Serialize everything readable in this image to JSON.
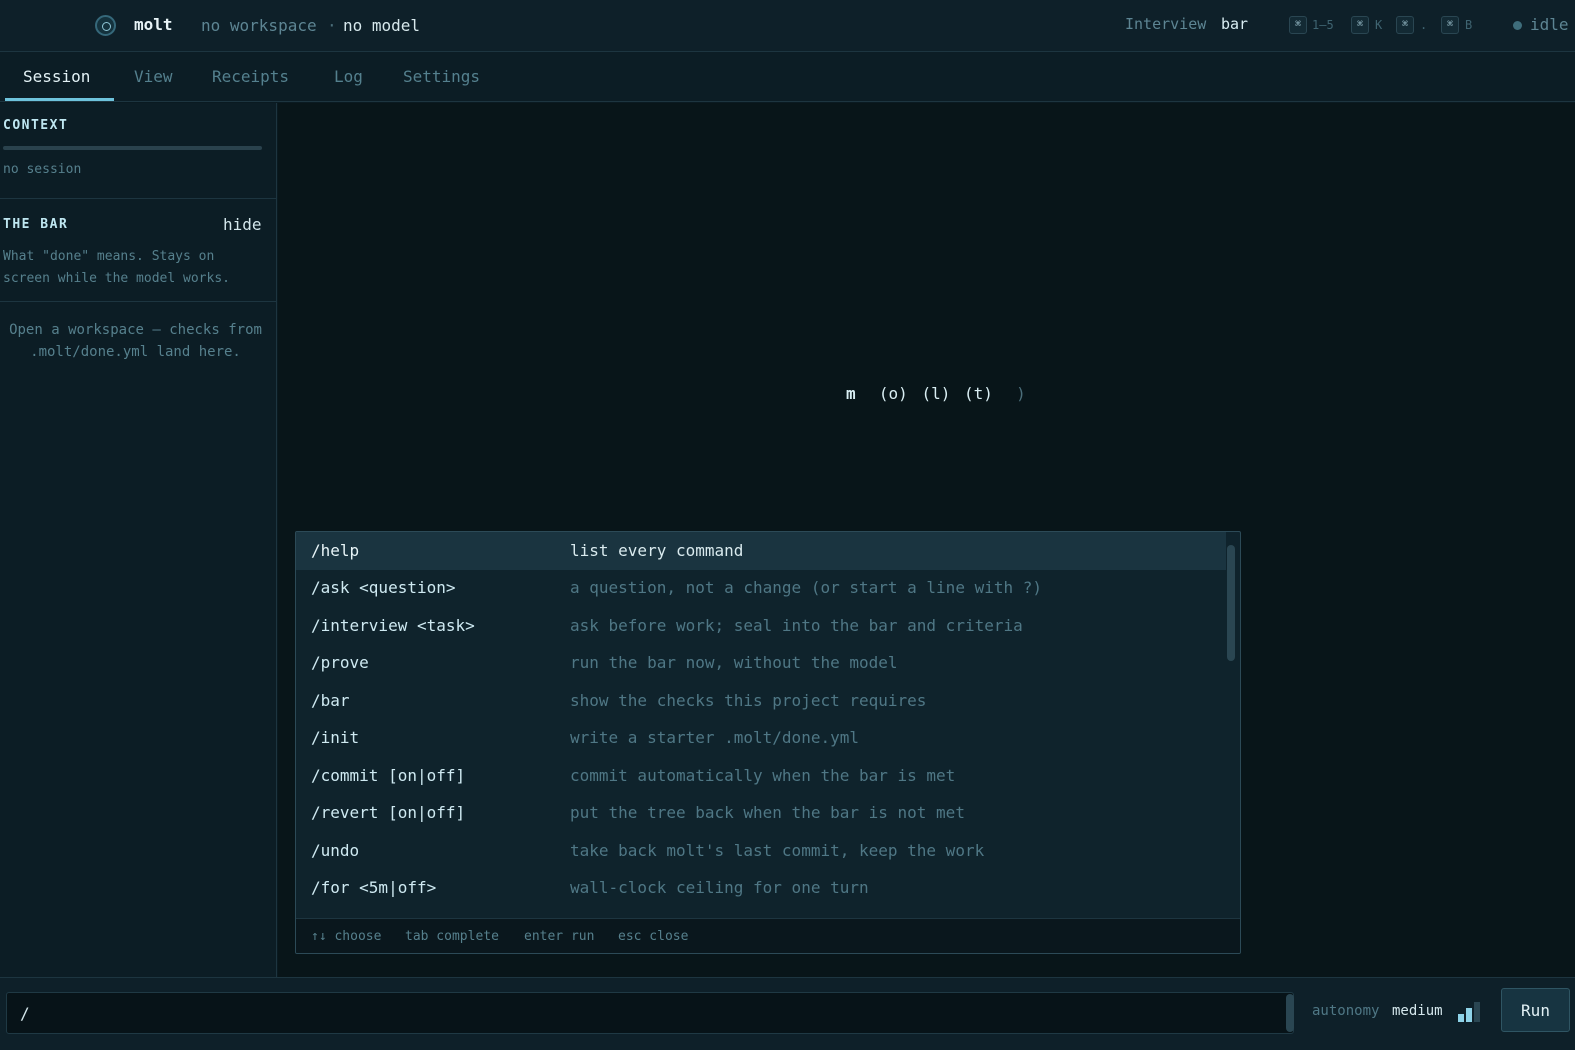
{
  "header": {
    "app_name": "molt",
    "workspace": "no workspace",
    "separator": "·",
    "model": "no model",
    "mode_label": "Interview",
    "mode_value": "bar",
    "shortcuts": [
      {
        "key": "⌘",
        "hint": "1–5"
      },
      {
        "key": "⌘",
        "hint": "K"
      },
      {
        "key": "⌘",
        "hint": "."
      },
      {
        "key": "⌘",
        "hint": "B"
      }
    ],
    "status": "idle",
    "icons": {
      "logo": "molt-logo-icon",
      "status": "status-dot-icon",
      "command_key": "command-key-icon"
    }
  },
  "tabs": [
    "Session",
    "View",
    "Receipts",
    "Log",
    "Settings"
  ],
  "active_tab": "Session",
  "sidebar": {
    "context_title": "CONTEXT",
    "context_value": "no session",
    "bar_title": "THE BAR",
    "hide_label": "hide",
    "bar_description": "What \"done\" means. Stays on screen while the model works.",
    "empty_note": "Open a workspace — checks from .molt/done.yml land here."
  },
  "main": {
    "wordmark": [
      "m",
      "(o)",
      "(l)",
      "(t)",
      ")"
    ]
  },
  "palette": {
    "commands": [
      {
        "cmd": "/help",
        "desc": "list every command",
        "selected": true
      },
      {
        "cmd": "/ask <question>",
        "desc": "a question, not a change (or start a line with ?)"
      },
      {
        "cmd": "/interview <task>",
        "desc": "ask before work; seal into the bar and criteria"
      },
      {
        "cmd": "/prove",
        "desc": "run the bar now, without the model"
      },
      {
        "cmd": "/bar",
        "desc": "show the checks this project requires"
      },
      {
        "cmd": "/init",
        "desc": "write a starter .molt/done.yml"
      },
      {
        "cmd": "/commit [on|off]",
        "desc": "commit automatically when the bar is met"
      },
      {
        "cmd": "/revert [on|off]",
        "desc": "put the tree back when the bar is not met"
      },
      {
        "cmd": "/undo",
        "desc": "take back molt's last commit, keep the work"
      },
      {
        "cmd": "/for <5m|off>",
        "desc": "wall-clock ceiling for one turn"
      }
    ],
    "footer": [
      "↑↓ choose",
      "tab complete",
      "enter run",
      "esc close"
    ]
  },
  "input": {
    "value": "/"
  },
  "autonomy": {
    "label": "autonomy",
    "value": "medium",
    "level_filled": 2,
    "level_total": 3
  },
  "run_label": "Run",
  "colors": {
    "background": "#0a1a21",
    "accent": "#6ec3dc",
    "text": "#cfe3e8",
    "muted": "#56808d"
  }
}
